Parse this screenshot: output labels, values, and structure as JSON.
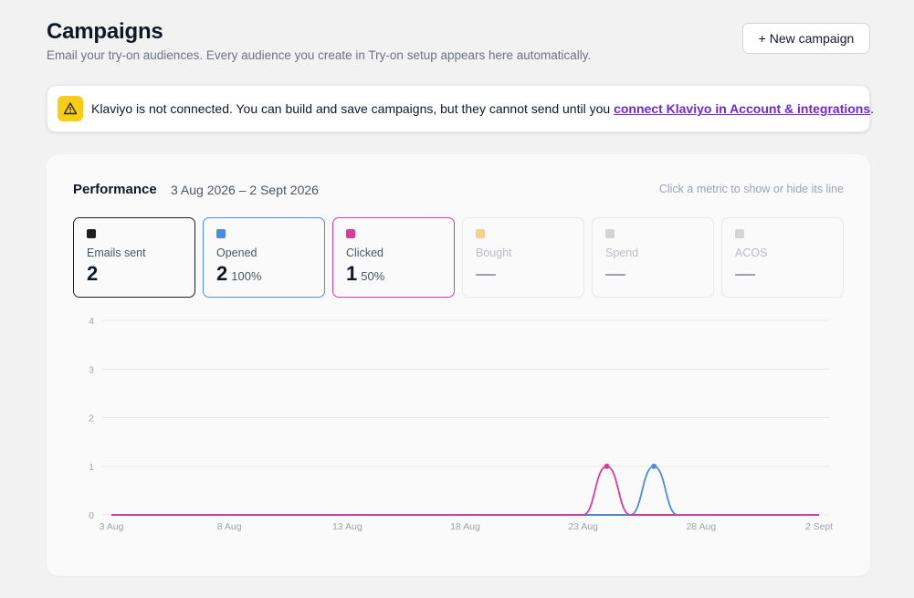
{
  "page": {
    "title": "Campaigns",
    "subtitle": "Email your try-on audiences. Every audience you create in Try-on setup appears here automatically.",
    "new_campaign_label": "+ New campaign"
  },
  "alert": {
    "icon": "warning-icon",
    "text": "Klaviyo is not connected. You can build and save campaigns, but they cannot send until you ",
    "link_text": "connect Klaviyo in Account & integrations",
    "suffix": "."
  },
  "performance": {
    "title": "Performance",
    "range": "3 Aug 2026 – 2 Sept 2026",
    "hint": "Click a metric to show or hide its line"
  },
  "metrics": [
    {
      "label": "Emails sent",
      "value": "2",
      "pct": "",
      "color": "#1f1f1f",
      "active": true
    },
    {
      "label": "Opened",
      "value": "2",
      "pct": "100%",
      "color": "#4a8de0",
      "active": true
    },
    {
      "label": "Clicked",
      "value": "1",
      "pct": "50%",
      "color": "#db3b9b",
      "active": true
    },
    {
      "label": "Bought",
      "value": "",
      "pct": "",
      "color": "#f8cf8f",
      "active": false
    },
    {
      "label": "Spend",
      "value": "",
      "pct": "",
      "color": "#d4d4d4",
      "active": false
    },
    {
      "label": "ACOS",
      "value": "",
      "pct": "",
      "color": "#d4d4d4",
      "active": false
    }
  ],
  "chart_data": {
    "type": "line",
    "x": [
      "3 Aug",
      "4 Aug",
      "5 Aug",
      "6 Aug",
      "7 Aug",
      "8 Aug",
      "9 Aug",
      "10 Aug",
      "11 Aug",
      "12 Aug",
      "13 Aug",
      "14 Aug",
      "15 Aug",
      "16 Aug",
      "17 Aug",
      "18 Aug",
      "19 Aug",
      "20 Aug",
      "21 Aug",
      "22 Aug",
      "23 Aug",
      "24 Aug",
      "25 Aug",
      "26 Aug",
      "27 Aug",
      "28 Aug",
      "29 Aug",
      "30 Aug",
      "31 Aug",
      "1 Sept",
      "2 Sept"
    ],
    "x_tick_labels": [
      "3 Aug",
      "8 Aug",
      "13 Aug",
      "18 Aug",
      "23 Aug",
      "28 Aug",
      "2 Sept"
    ],
    "y_ticks": [
      "0",
      "1",
      "2",
      "3",
      "4"
    ],
    "ylim": [
      0,
      4
    ],
    "grid": true,
    "series": [
      {
        "name": "Emails sent",
        "color": "#1f1f1f",
        "values": [
          0,
          0,
          0,
          0,
          0,
          0,
          0,
          0,
          0,
          0,
          0,
          0,
          0,
          0,
          0,
          0,
          0,
          0,
          0,
          0,
          0,
          0,
          0,
          0,
          0,
          0,
          0,
          0,
          0,
          0,
          0
        ]
      },
      {
        "name": "Opened",
        "color": "#4a8de0",
        "values": [
          0,
          0,
          0,
          0,
          0,
          0,
          0,
          0,
          0,
          0,
          0,
          0,
          0,
          0,
          0,
          0,
          0,
          0,
          0,
          0,
          0,
          0,
          0,
          1,
          0,
          0,
          0,
          0,
          0,
          0,
          0
        ]
      },
      {
        "name": "Clicked",
        "color": "#db3b9b",
        "values": [
          0,
          0,
          0,
          0,
          0,
          0,
          0,
          0,
          0,
          0,
          0,
          0,
          0,
          0,
          0,
          0,
          0,
          0,
          0,
          0,
          0,
          1,
          0,
          0,
          0,
          0,
          0,
          0,
          0,
          0,
          0
        ]
      }
    ]
  }
}
